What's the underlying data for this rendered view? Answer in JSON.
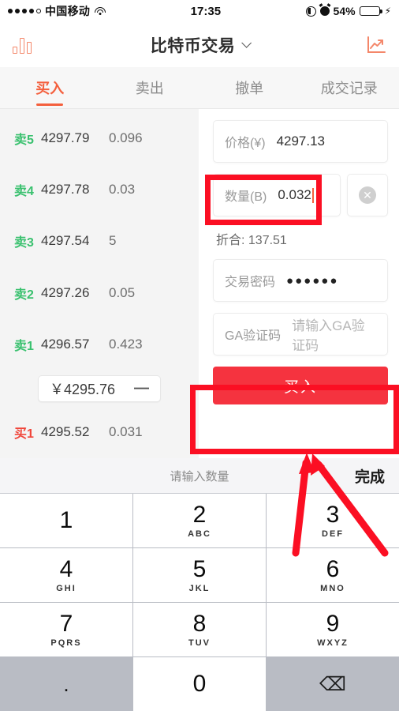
{
  "status_bar": {
    "signal_dots_filled": 4,
    "signal_dots_total": 5,
    "carrier": "中国移动",
    "wifi_icon": "wifi-icon",
    "time": "17:35",
    "location_icon": "location-icon",
    "alarm_icon": "alarm-icon",
    "battery_percent": "54%",
    "battery_level": 54,
    "charging_icon": "⚡"
  },
  "navbar": {
    "left_icon": "bar-chart-icon",
    "title": "比特币交易",
    "dropdown_icon": "chevron-down-icon",
    "right_icon": "trend-chart-icon"
  },
  "tabs": [
    {
      "label": "买入",
      "active": true
    },
    {
      "label": "卖出",
      "active": false
    },
    {
      "label": "撤单",
      "active": false
    },
    {
      "label": "成交记录",
      "active": false
    }
  ],
  "orderbook": {
    "asks": [
      {
        "tag": "卖5",
        "price": "4297.79",
        "amount": "0.096"
      },
      {
        "tag": "卖4",
        "price": "4297.78",
        "amount": "0.03"
      },
      {
        "tag": "卖3",
        "price": "4297.54",
        "amount": "5"
      },
      {
        "tag": "卖2",
        "price": "4297.26",
        "amount": "0.05"
      },
      {
        "tag": "卖1",
        "price": "4296.57",
        "amount": "0.423"
      }
    ],
    "current": {
      "price": "￥4295.76",
      "change": "—"
    },
    "bids": [
      {
        "tag": "买1",
        "price": "4295.52",
        "amount": "0.031"
      }
    ],
    "ask_color": "#3ac16f",
    "bid_color": "#f0453a"
  },
  "form": {
    "price": {
      "label": "价格(¥)",
      "value": "4297.13"
    },
    "quantity": {
      "label": "数量(B)",
      "value": "0.032",
      "clear_icon": "clear-circle-icon"
    },
    "convert": "折合: 137.51",
    "password": {
      "label": "交易密码",
      "value": "●●●●●●"
    },
    "ga_code": {
      "label": "GA验证码",
      "placeholder": "请输入GA验证码",
      "value": ""
    },
    "submit_label": "买入",
    "submit_color": "#f5333f"
  },
  "annotations": {
    "highlight_color": "#fb0f23",
    "boxes": [
      "quantity-field",
      "buy-button"
    ],
    "arrows": 2
  },
  "keyboard": {
    "hint": "请输入数量",
    "done_label": "完成",
    "keys": [
      {
        "num": "1",
        "sub": ""
      },
      {
        "num": "2",
        "sub": "ABC"
      },
      {
        "num": "3",
        "sub": "DEF"
      },
      {
        "num": "4",
        "sub": "GHI"
      },
      {
        "num": "5",
        "sub": "JKL"
      },
      {
        "num": "6",
        "sub": "MNO"
      },
      {
        "num": "7",
        "sub": "PQRS"
      },
      {
        "num": "8",
        "sub": "TUV"
      },
      {
        "num": "9",
        "sub": "WXYZ"
      },
      {
        "num": ".",
        "sub": ""
      },
      {
        "num": "0",
        "sub": ""
      },
      {
        "num": "⌫",
        "sub": ""
      }
    ]
  }
}
